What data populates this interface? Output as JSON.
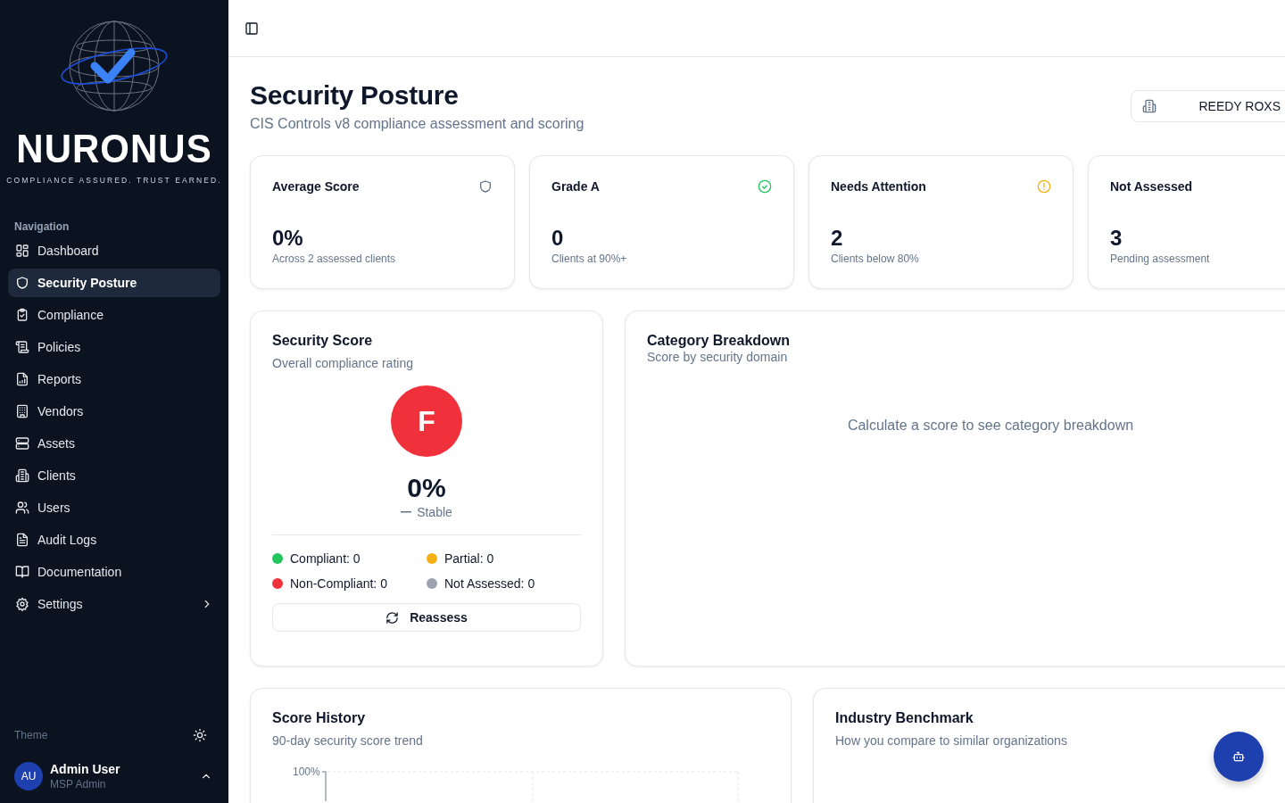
{
  "sidebar": {
    "brand": "NURONUS",
    "tagline": "COMPLIANCE ASSURED. TRUST EARNED.",
    "section_label": "Navigation",
    "items": [
      {
        "label": "Dashboard",
        "selected": false
      },
      {
        "label": "Security Posture",
        "selected": true
      },
      {
        "label": "Compliance",
        "selected": false
      },
      {
        "label": "Policies",
        "selected": false
      },
      {
        "label": "Reports",
        "selected": false
      },
      {
        "label": "Vendors",
        "selected": false
      },
      {
        "label": "Assets",
        "selected": false
      },
      {
        "label": "Clients",
        "selected": false
      },
      {
        "label": "Users",
        "selected": false
      },
      {
        "label": "Audit Logs",
        "selected": false
      },
      {
        "label": "Documentation",
        "selected": false
      },
      {
        "label": "Settings",
        "selected": false,
        "expandable": true
      }
    ],
    "theme_label": "Theme",
    "user": {
      "initials": "AU",
      "name": "Admin User",
      "role": "MSP Admin"
    }
  },
  "page": {
    "title": "Security Posture",
    "subtitle": "CIS Controls v8 compliance assessment and scoring",
    "client_selector": "REEDY ROXS"
  },
  "stats": [
    {
      "title": "Average Score",
      "value": "0%",
      "note": "Across 2 assessed clients",
      "kind": "shield"
    },
    {
      "title": "Grade A",
      "value": "0",
      "note": "Clients at 90%+",
      "kind": "check"
    },
    {
      "title": "Needs Attention",
      "value": "2",
      "note": "Clients below 80%",
      "kind": "alert"
    },
    {
      "title": "Not Assessed",
      "value": "3",
      "note": "Pending assessment",
      "kind": "none"
    }
  ],
  "security_score": {
    "title": "Security Score",
    "subtitle": "Overall compliance rating",
    "grade": "F",
    "percent": "0%",
    "trend": "Stable",
    "legend": [
      {
        "label": "Compliant: 0",
        "color": "#22c55e"
      },
      {
        "label": "Partial: 0",
        "color": "#f5b016"
      },
      {
        "label": "Non-Compliant: 0",
        "color": "#f0303a"
      },
      {
        "label": "Not Assessed: 0",
        "color": "#9ca3af"
      }
    ],
    "button": "Reassess"
  },
  "category_breakdown": {
    "title": "Category Breakdown",
    "subtitle": "Score by security domain",
    "empty_message": "Calculate a score to see category breakdown"
  },
  "score_history": {
    "title": "Score History",
    "subtitle": "90-day security score trend",
    "y_tick": "100%"
  },
  "industry_benchmark": {
    "title": "Industry Benchmark",
    "subtitle": "How you compare to similar organizations"
  }
}
